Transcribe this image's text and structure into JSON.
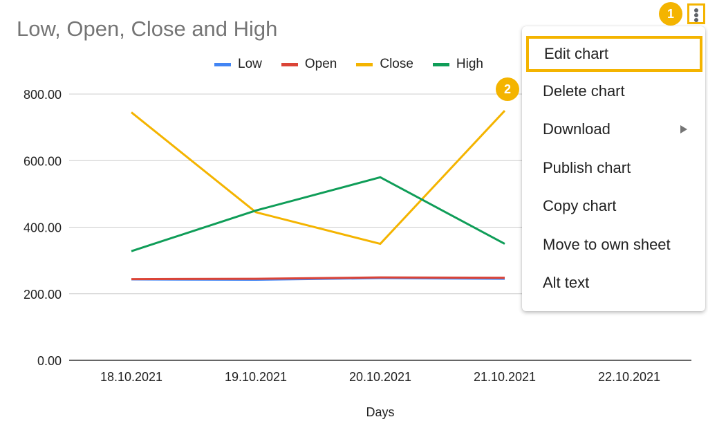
{
  "chart_data": {
    "type": "line",
    "title": "Low, Open, Close and High",
    "xlabel": "Days",
    "ylabel": "",
    "categories": [
      "18.10.2021",
      "19.10.2021",
      "20.10.2021",
      "21.10.2021",
      "22.10.2021"
    ],
    "ylim": [
      0,
      800
    ],
    "yticks": [
      "0.00",
      "200.00",
      "400.00",
      "600.00",
      "800.00"
    ],
    "grid": true,
    "legend_position": "top",
    "series": [
      {
        "name": "Low",
        "color": "#4285f4",
        "values": [
          243,
          242,
          247,
          245,
          null
        ]
      },
      {
        "name": "Open",
        "color": "#db4437",
        "values": [
          244,
          245,
          249,
          248,
          null
        ]
      },
      {
        "name": "Close",
        "color": "#f4b400",
        "values": [
          745,
          445,
          350,
          750,
          null
        ]
      },
      {
        "name": "High",
        "color": "#0f9d58",
        "values": [
          328,
          450,
          550,
          350,
          null
        ]
      }
    ]
  },
  "menu": {
    "items": [
      {
        "label": "Edit chart",
        "highlight": true,
        "submenu": false
      },
      {
        "label": "Delete chart",
        "highlight": false,
        "submenu": false
      },
      {
        "label": "Download",
        "highlight": false,
        "submenu": true
      },
      {
        "label": "Publish chart",
        "highlight": false,
        "submenu": false
      },
      {
        "label": "Copy chart",
        "highlight": false,
        "submenu": false
      },
      {
        "label": "Move to own sheet",
        "highlight": false,
        "submenu": false
      },
      {
        "label": "Alt text",
        "highlight": false,
        "submenu": false
      }
    ]
  },
  "annotations": {
    "badge_1": "1",
    "badge_2": "2",
    "color": "#f4b400"
  }
}
